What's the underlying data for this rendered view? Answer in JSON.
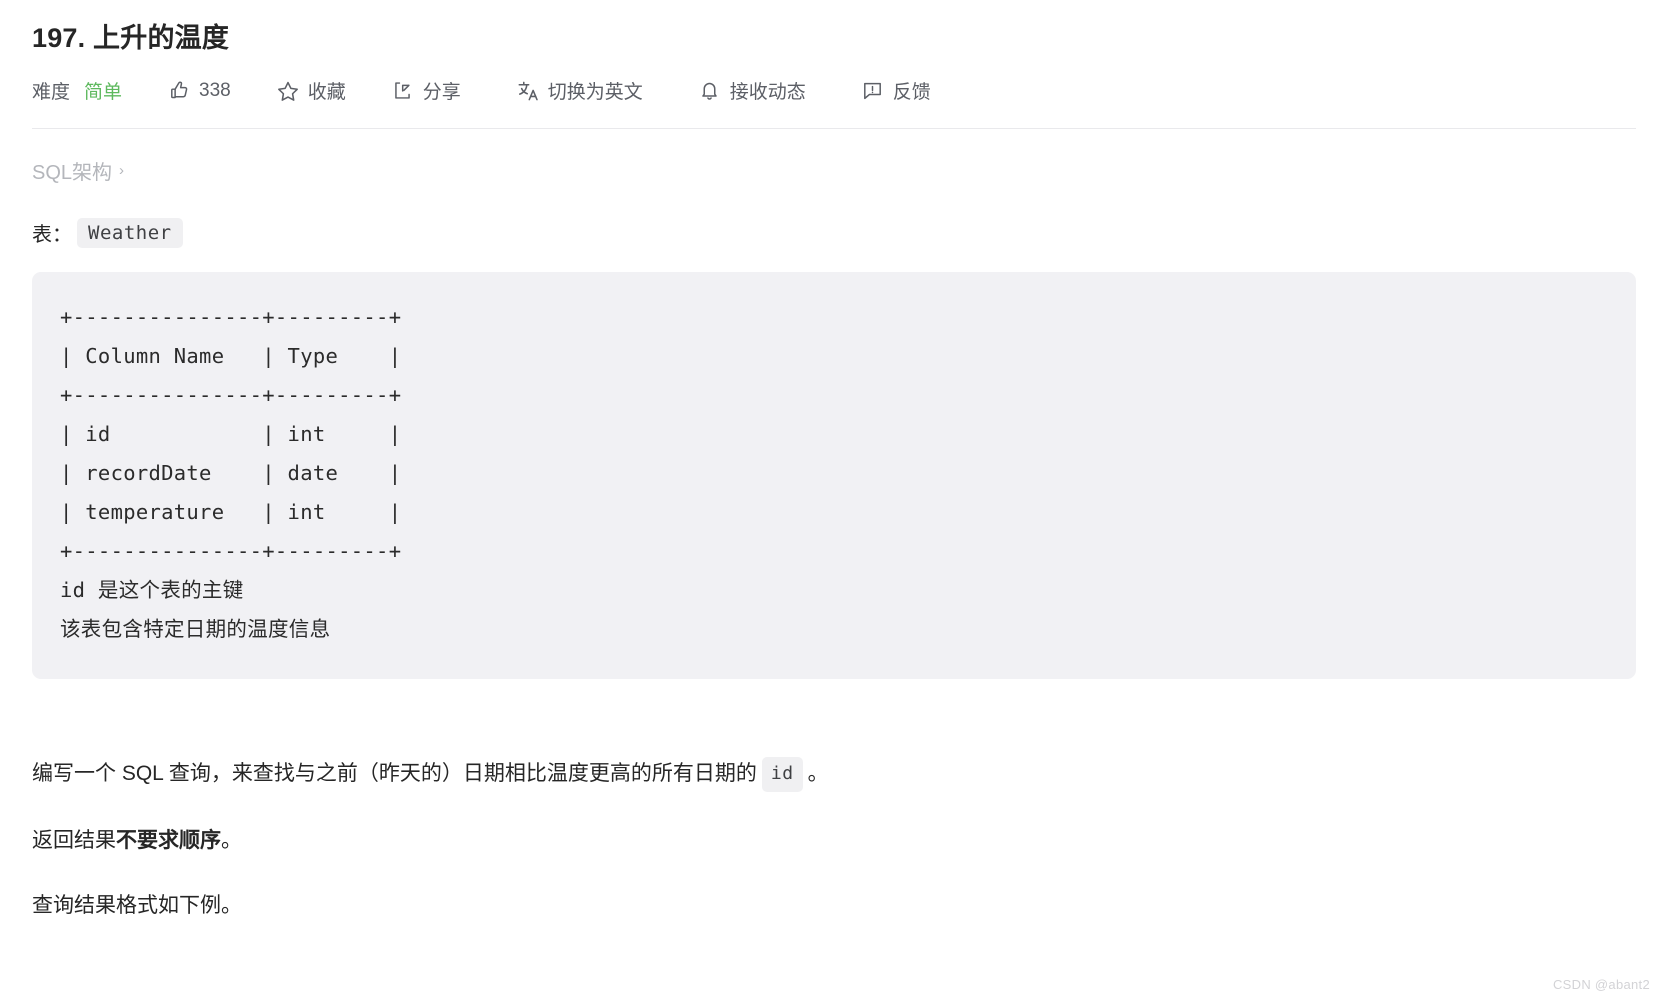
{
  "problem": {
    "title": "197. 上升的温度"
  },
  "toolbar": {
    "difficulty_label": "难度",
    "difficulty_value": "简单",
    "difficulty_color": "#5eb95e",
    "like_count": "338",
    "favorite_label": "收藏",
    "share_label": "分享",
    "translate_label": "切换为英文",
    "subscribe_label": "接收动态",
    "feedback_label": "反馈"
  },
  "breadcrumb": {
    "label": "SQL架构",
    "chevron": "›"
  },
  "schema": {
    "table_prefix": "表：",
    "table_name": "Weather",
    "code": "+---------------+---------+\n| Column Name   | Type    |\n+---------------+---------+\n| id            | int     |\n| recordDate    | date    |\n| temperature   | int     |\n+---------------+---------+\nid 是这个表的主键\n该表包含特定日期的温度信息"
  },
  "description": {
    "p1_before": "编写一个 SQL 查询，来查找与之前（昨天的）日期相比温度更高的所有日期的",
    "p1_code": "id",
    "p1_after": "。",
    "p2_before": "返回结果 ",
    "p2_strong": "不要求顺序",
    "p2_after": " 。",
    "p3": "查询结果格式如下例。"
  },
  "watermark": {
    "text": "CSDN @abant2"
  }
}
